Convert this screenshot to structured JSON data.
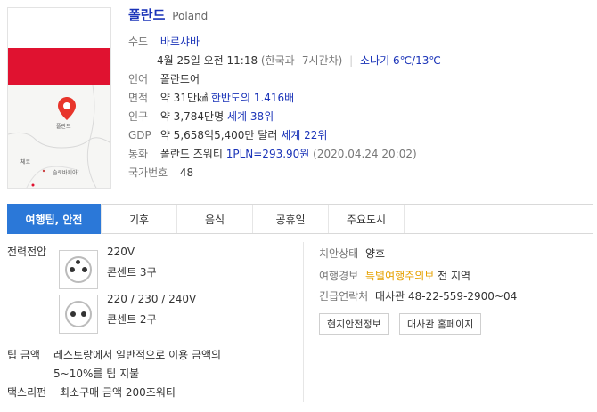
{
  "map": {
    "pin_label": "폴란드",
    "label_czech": "체코",
    "label_slovakia": "슬로바키아"
  },
  "country": {
    "name_ko": "폴란드",
    "name_en": "Poland"
  },
  "info": {
    "capital_key": "수도",
    "capital_value": "바르샤바",
    "local_time": "4월 25일 오전 11:18",
    "time_diff": "(한국과 -7시간차)",
    "weather": "소나기 6℃/13℃",
    "language_key": "언어",
    "language_value": "폴란드어",
    "area_key": "면적",
    "area_value": "약 31만㎢",
    "area_compare": "한반도의 1.416배",
    "population_key": "인구",
    "population_value": "약 3,784만명",
    "population_rank": "세계 38위",
    "gdp_key": "GDP",
    "gdp_value": "약 5,658억5,400만 달러",
    "gdp_rank": "세계 22위",
    "currency_key": "통화",
    "currency_value": "폴란드 즈워티",
    "currency_rate": "1PLN=293.90원",
    "currency_date": "(2020.04.24 20:02)",
    "calling_key": "국가번호",
    "calling_value": "48"
  },
  "tabs": [
    "여행팁, 안전",
    "기후",
    "음식",
    "공휴일",
    "주요도시"
  ],
  "travel": {
    "voltage_key": "전력전압",
    "socket1_voltage": "220V",
    "socket1_desc": "콘센트 3구",
    "socket2_voltage": "220 / 230 / 240V",
    "socket2_desc": "콘센트 2구",
    "tip_key": "팁 금액",
    "tip_line1": "레스토랑에서 일반적으로 이용 금액의",
    "tip_line2": "5~10%를 팁 지불",
    "taxi_key": "택스리펀",
    "taxi_value": "최소구매 금액 200즈워티"
  },
  "safety": {
    "security_key": "치안상태",
    "security_value": "양호",
    "alert_key": "여행경보",
    "alert_level": "특별여행주의보",
    "alert_area": "전 지역",
    "contact_key": "긴급연락처",
    "contact_value": "대사관 48-22-559-2900~04",
    "btn_local_safety": "현지안전정보",
    "btn_embassy": "대사관 홈페이지"
  },
  "colors": {
    "accent": "#2b78d8",
    "link": "#1a33b8",
    "warning": "#e6a100",
    "flag_red": "#e01230"
  }
}
